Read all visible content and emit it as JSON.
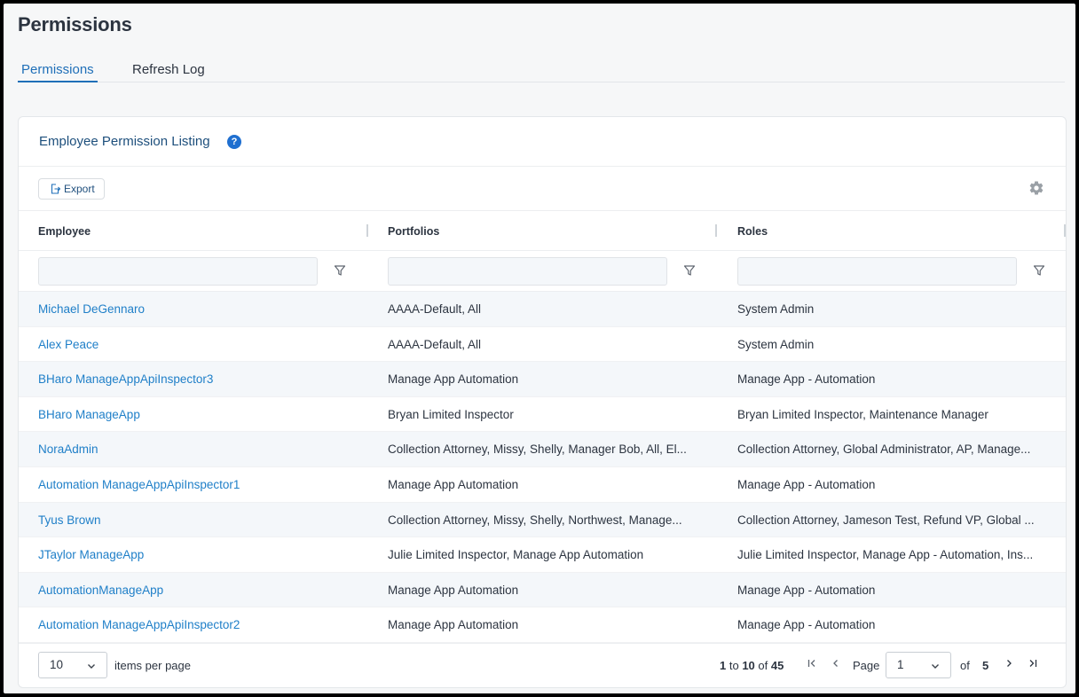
{
  "page": {
    "title": "Permissions"
  },
  "tabs": [
    {
      "label": "Permissions",
      "active": true
    },
    {
      "label": "Refresh Log",
      "active": false
    }
  ],
  "card": {
    "title": "Employee Permission Listing",
    "help_icon": "question-circle-icon",
    "help_text": "?",
    "export_label": "Export",
    "settings_icon": "gear-icon"
  },
  "columns": [
    "Employee",
    "Portfolios",
    "Roles"
  ],
  "rows": [
    {
      "employee": "Michael DeGennaro",
      "portfolios": "AAAA-Default, All",
      "roles": "System Admin"
    },
    {
      "employee": "Alex Peace",
      "portfolios": "AAAA-Default, All",
      "roles": "System Admin"
    },
    {
      "employee": "BHaro ManageAppApiInspector3",
      "portfolios": "Manage App Automation",
      "roles": "Manage App - Automation"
    },
    {
      "employee": "BHaro ManageApp",
      "portfolios": "Bryan Limited Inspector",
      "roles": "Bryan Limited Inspector, Maintenance Manager"
    },
    {
      "employee": "NoraAdmin",
      "portfolios": "Collection Attorney, Missy, Shelly, Manager Bob, All, El...",
      "roles": "Collection Attorney, Global Administrator, AP, Manage..."
    },
    {
      "employee": "Automation ManageAppApiInspector1",
      "portfolios": "Manage App Automation",
      "roles": "Manage App - Automation"
    },
    {
      "employee": "Tyus Brown",
      "portfolios": "Collection Attorney, Missy, Shelly, Northwest, Manage...",
      "roles": "Collection Attorney, Jameson Test, Refund VP, Global ..."
    },
    {
      "employee": "JTaylor ManageApp",
      "portfolios": "Julie Limited Inspector, Manage App Automation",
      "roles": "Julie Limited Inspector, Manage App - Automation, Ins..."
    },
    {
      "employee": "AutomationManageApp",
      "portfolios": "Manage App Automation",
      "roles": "Manage App - Automation"
    },
    {
      "employee": "Automation ManageAppApiInspector2",
      "portfolios": "Manage App Automation",
      "roles": "Manage App - Automation"
    }
  ],
  "pagination": {
    "per_page": "10",
    "per_page_label": "items per page",
    "range_from": "1",
    "range_to_word": "to",
    "range_to": "10",
    "range_of_word": "of",
    "range_total": "45",
    "page_label": "Page",
    "current_page": "1",
    "of_label": "of",
    "total_pages": "5"
  },
  "colors": {
    "accent": "#1f6fb8",
    "link": "#1f7fc8",
    "stripe": "#f4f7fa"
  }
}
